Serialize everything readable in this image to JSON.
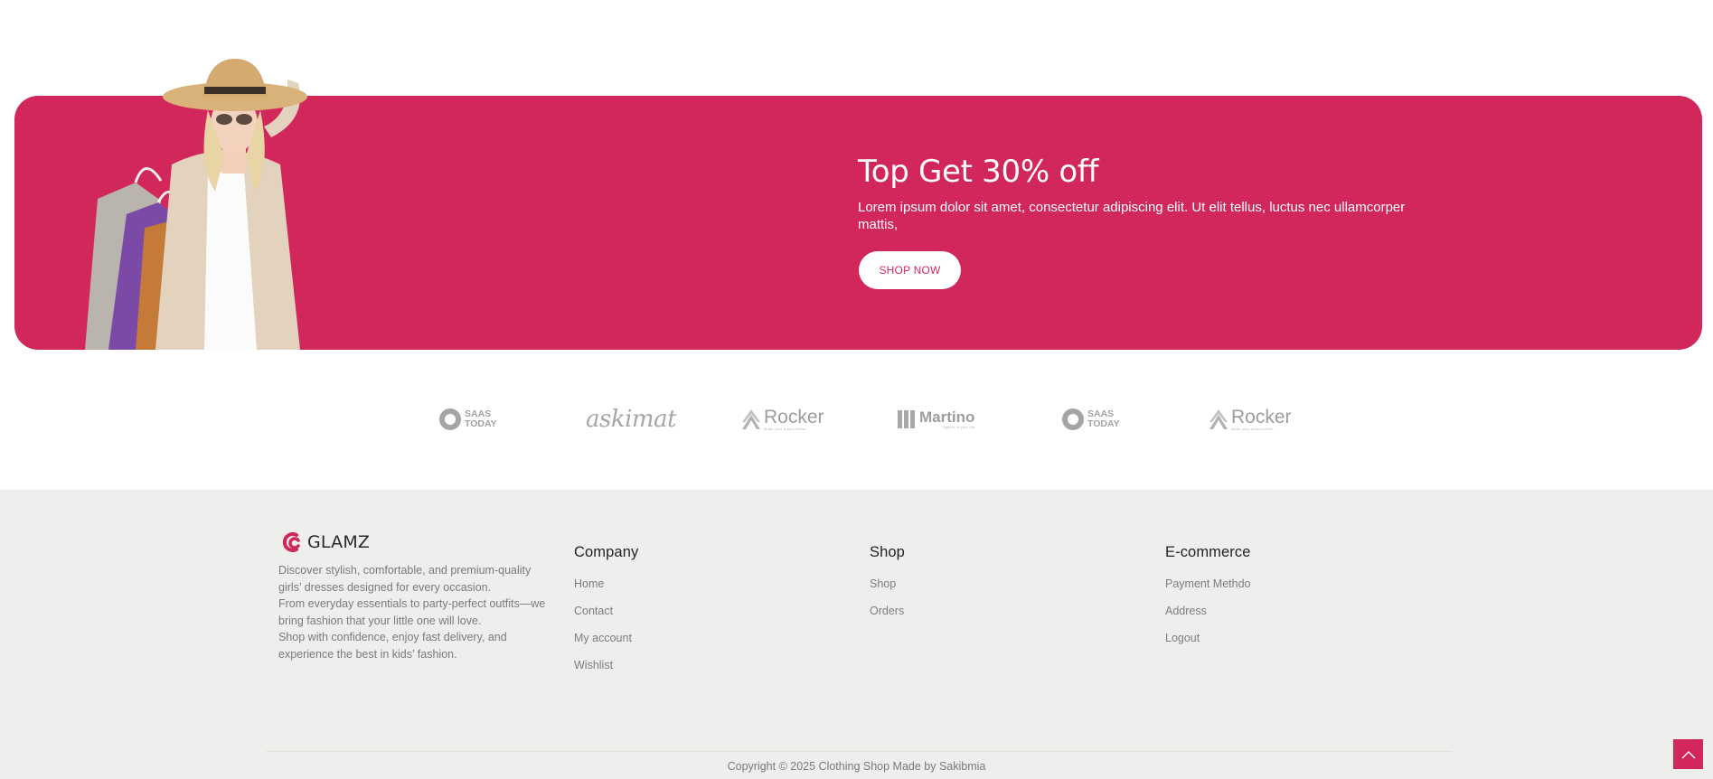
{
  "promo": {
    "title": "Top Get 30% off",
    "description": "Lorem ipsum dolor sit amet, consectetur adipiscing elit. Ut elit tellus, luctus nec ullamcorper mattis,",
    "button_label": "SHOP NOW",
    "accent_color": "#d2275b"
  },
  "brands": [
    {
      "icon": "saas-today-logo",
      "line1": "SAAS",
      "line2": "TODAY"
    },
    {
      "icon": "askimat-logo",
      "name": "askimat"
    },
    {
      "icon": "rocker-logo",
      "name": "Rocker",
      "tagline": "Make your dream better"
    },
    {
      "icon": "martino-logo",
      "name": "Martino",
      "tagline": "Tagline of your life"
    },
    {
      "icon": "saas-today-logo",
      "line1": "SAAS",
      "line2": "TODAY"
    },
    {
      "icon": "rocker-logo",
      "name": "Rocker",
      "tagline": "Make your dream better"
    }
  ],
  "footer": {
    "logo_text": "GLAMZ",
    "about": [
      "Discover stylish, comfortable, and premium-quality girls’ dresses designed for every occasion.",
      "From everyday essentials to party-perfect outfits—we bring fashion that your little one will love.",
      "Shop with confidence, enjoy fast delivery, and experience the best in kids’ fashion."
    ],
    "columns": [
      {
        "title": "Company",
        "links": [
          "Home",
          "Contact",
          "My account",
          "Wishlist"
        ]
      },
      {
        "title": "Shop",
        "links": [
          "Shop",
          "Orders"
        ]
      },
      {
        "title": "E-commerce",
        "links": [
          "Payment Methdo",
          "Address",
          "Logout"
        ]
      }
    ],
    "copyright": "Copyright © 2025 Clothing Shop Made by Sakibmia"
  },
  "icons": {
    "scroll_top": "chevron-up-icon"
  }
}
